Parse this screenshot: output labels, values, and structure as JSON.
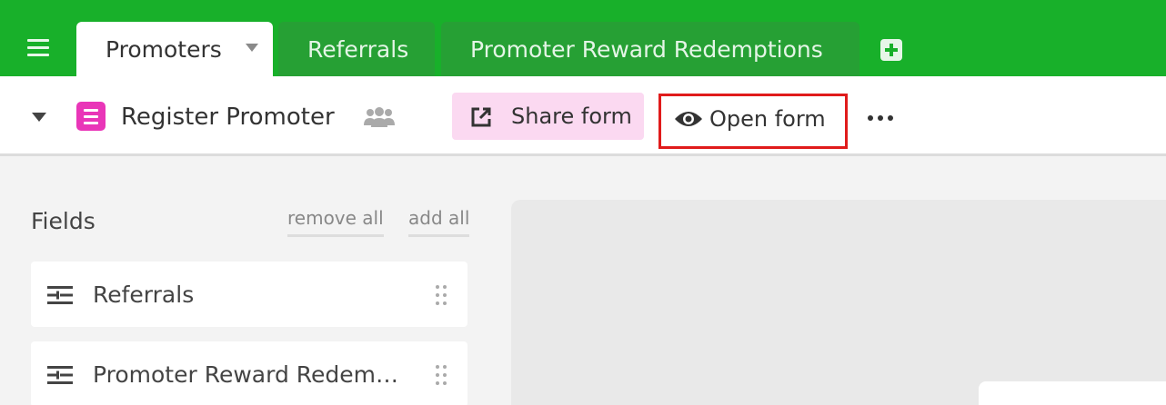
{
  "tabs": [
    {
      "label": "Promoters",
      "active": true
    },
    {
      "label": "Referrals",
      "active": false
    },
    {
      "label": "Promoter Reward Redemptions",
      "active": false
    }
  ],
  "toolbar": {
    "view_title": "Register Promoter",
    "share_label": "Share form",
    "open_label": "Open form"
  },
  "fields_panel": {
    "title": "Fields",
    "remove_all": "remove all",
    "add_all": "add all",
    "items": [
      {
        "label": "Referrals"
      },
      {
        "label": "Promoter Reward Redemptions"
      }
    ]
  },
  "colors": {
    "brand_green": "#18b02a",
    "form_icon_pink": "#e936b8",
    "share_button_bg": "#fbd9f1",
    "highlight_red": "#e01b1b"
  },
  "icons": [
    "hamburger-menu-icon",
    "caret-down-icon",
    "add-tab-icon",
    "form-view-icon",
    "people-icon",
    "share-external-icon",
    "eye-icon",
    "more-icon",
    "link-field-icon",
    "drag-handle-icon"
  ]
}
